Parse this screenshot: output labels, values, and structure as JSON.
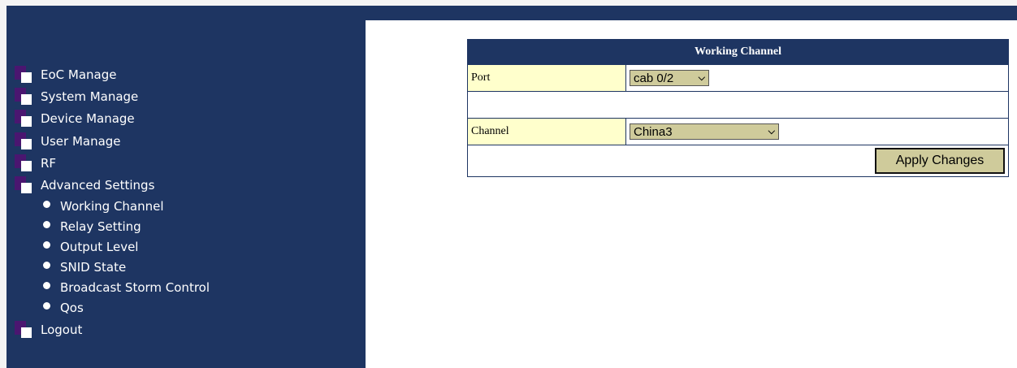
{
  "sidebar": {
    "items": [
      {
        "label": "EoC Manage"
      },
      {
        "label": "System Manage"
      },
      {
        "label": "Device Manage"
      },
      {
        "label": "User Manage"
      },
      {
        "label": "RF"
      },
      {
        "label": "Advanced Settings"
      }
    ],
    "advanced_sub": [
      {
        "label": "Working Channel"
      },
      {
        "label": "Relay Setting"
      },
      {
        "label": "Output Level"
      },
      {
        "label": "SNID State"
      },
      {
        "label": "Broadcast Storm Control"
      },
      {
        "label": "Qos"
      }
    ],
    "logout": {
      "label": "Logout"
    }
  },
  "panel": {
    "title": "Working Channel",
    "port_label": "Port",
    "port_value": "cab 0/2",
    "channel_label": "Channel",
    "channel_value": "China3",
    "apply_label": "Apply Changes"
  },
  "colors": {
    "navy": "#1e3562",
    "folder_purple": "#4a1670",
    "label_bg": "#ffffcc",
    "control_bg": "#cfcb9b"
  },
  "icons": {
    "menu": "folder-icon",
    "submenu": "bullet-icon",
    "dropdown": "chevron-down-icon"
  }
}
